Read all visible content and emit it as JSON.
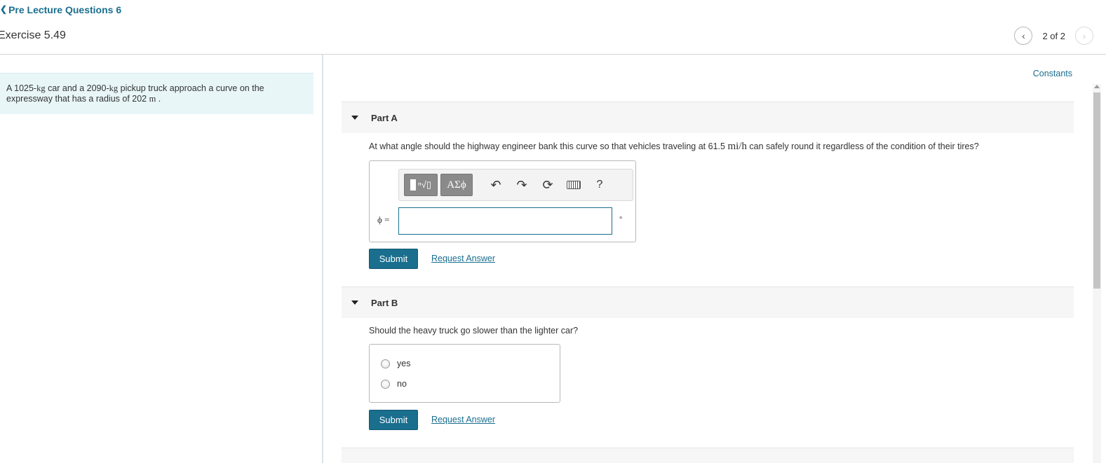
{
  "header": {
    "back_label": "Pre Lecture Questions 6",
    "exercise_title": "Exercise 5.49",
    "pager": {
      "current": "2 of 2"
    }
  },
  "problem": {
    "t1": "A 1025-",
    "u1": "kg",
    "t2": " car and a 2090-",
    "u2": "kg",
    "t3": " pickup truck approach a curve on the",
    "t4": "expressway that has a radius of 202 ",
    "u3": "m",
    "t5": " ."
  },
  "constants_label": "Constants",
  "partA": {
    "label": "Part A",
    "q1": "At what angle should the highway engineer bank this curve so that vehicles traveling at 61.5 ",
    "unit": "mi/h",
    "q2": " can safely round it regardless of the condition of their tires?",
    "toolbar": {
      "templates_icon": "radical-template-icon",
      "greek_label": "ΑΣϕ",
      "undo_icon": "undo-icon",
      "redo_icon": "redo-icon",
      "reset_icon": "reset-icon",
      "keyboard_icon": "keyboard-icon",
      "help_label": "?"
    },
    "variable_label": "ϕ =",
    "answer_value": "",
    "unit_symbol": "∘",
    "submit_label": "Submit",
    "request_label": "Request Answer"
  },
  "partB": {
    "label": "Part B",
    "question": "Should the heavy truck go slower than the lighter car?",
    "options": [
      "yes",
      "no"
    ],
    "submit_label": "Submit",
    "request_label": "Request Answer"
  },
  "colors": {
    "accent": "#1a6e8e",
    "problem_bg": "#e8f6f8",
    "part_header_bg": "#f6f6f6"
  }
}
